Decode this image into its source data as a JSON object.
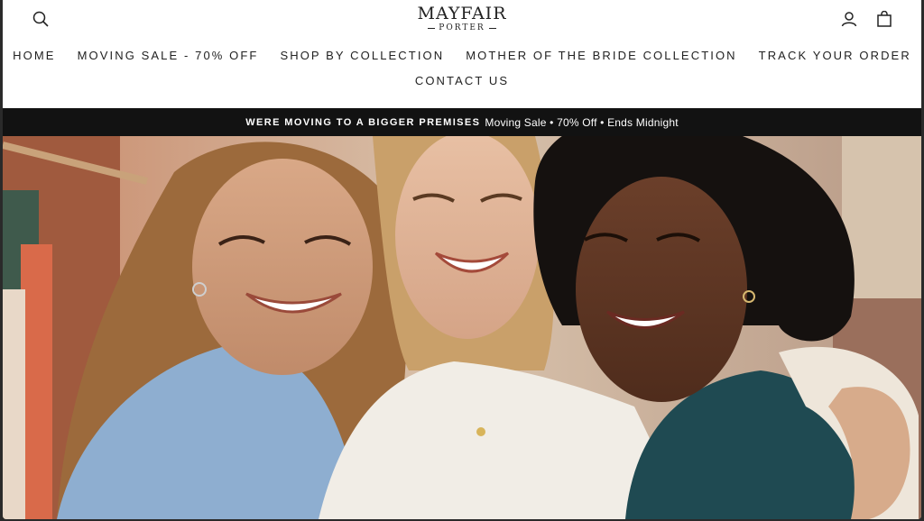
{
  "brand": {
    "name": "MAYFAIR",
    "sub": "PORTER"
  },
  "nav": {
    "row1": [
      "HOME",
      "MOVING SALE - 70% OFF",
      "SHOP BY COLLECTION",
      "MOTHER OF THE BRIDE COLLECTION",
      "TRACK YOUR ORDER"
    ],
    "row2": [
      "CONTACT US"
    ]
  },
  "icons": {
    "search": "search-icon",
    "account": "account-icon",
    "cart": "shopping-bag-icon"
  },
  "announcement": {
    "headline": "WERE MOVING TO A BIGGER PREMISES",
    "detail": "Moving Sale • 70% Off • Ends Midnight"
  },
  "colors": {
    "announcement_bg": "#121212",
    "text": "#222222"
  }
}
